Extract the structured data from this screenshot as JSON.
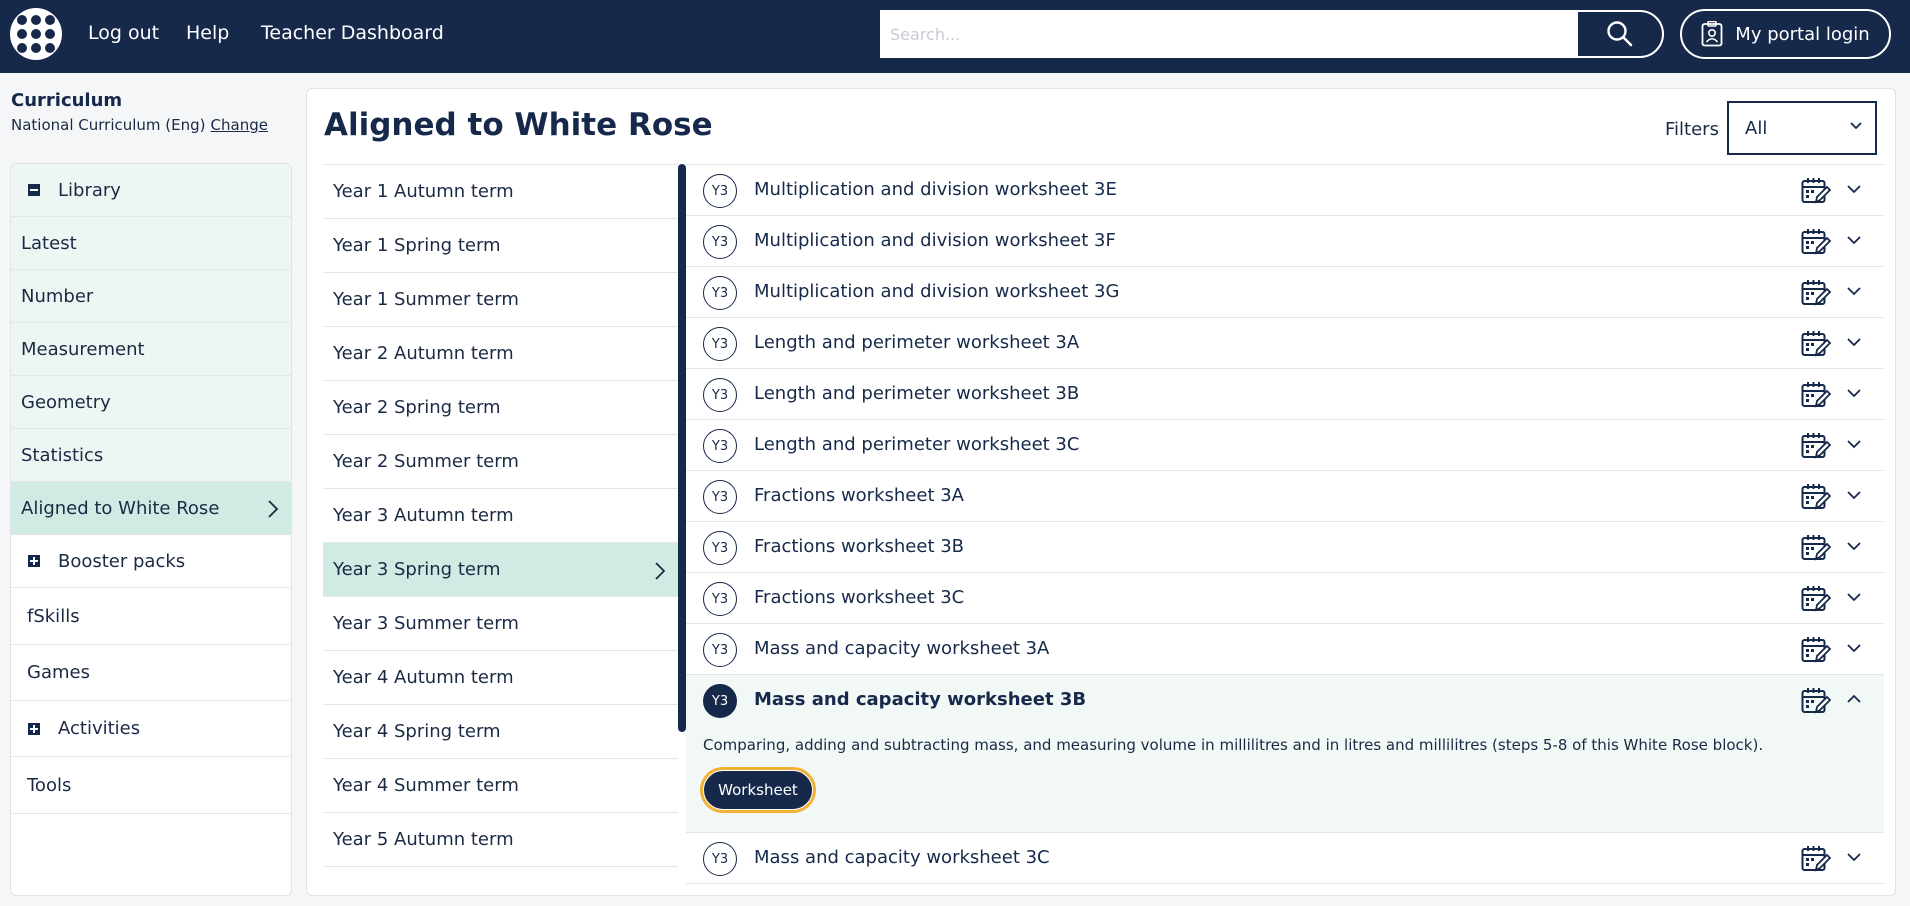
{
  "nav": {
    "links": [
      "Log out",
      "Help",
      "Teacher Dashboard"
    ],
    "search_placeholder": "Search...",
    "portal_label": "My portal login"
  },
  "sidebar": {
    "curriculum_title": "Curriculum",
    "curriculum_name": "National Curriculum (Eng)",
    "change_label": "Change",
    "items": [
      {
        "label": "Library",
        "icon": "minus-box-icon"
      },
      {
        "label": "Latest"
      },
      {
        "label": "Number"
      },
      {
        "label": "Measurement"
      },
      {
        "label": "Geometry"
      },
      {
        "label": "Statistics"
      },
      {
        "label": "Aligned to White Rose",
        "active": true
      },
      {
        "label": "Booster packs",
        "icon": "plus-box-icon"
      },
      {
        "label": "fSkills"
      },
      {
        "label": "Games"
      },
      {
        "label": "Activities",
        "icon": "plus-box-icon"
      },
      {
        "label": "Tools"
      }
    ]
  },
  "main": {
    "title": "Aligned to White Rose",
    "filters_label": "Filters",
    "filters_value": "All",
    "terms": [
      "Year 1 Autumn term",
      "Year 1 Spring term",
      "Year 1 Summer term",
      "Year 2 Autumn term",
      "Year 2 Spring term",
      "Year 2 Summer term",
      "Year 3 Autumn term",
      "Year 3 Spring term",
      "Year 3 Summer term",
      "Year 4 Autumn term",
      "Year 4 Spring term",
      "Year 4 Summer term",
      "Year 5 Autumn term"
    ],
    "active_term": "Year 3 Spring term",
    "resources": [
      {
        "badge": "Y3",
        "title": "Multiplication and division worksheet 3E"
      },
      {
        "badge": "Y3",
        "title": "Multiplication and division worksheet 3F"
      },
      {
        "badge": "Y3",
        "title": "Multiplication and division worksheet 3G"
      },
      {
        "badge": "Y3",
        "title": "Length and perimeter worksheet 3A"
      },
      {
        "badge": "Y3",
        "title": "Length and perimeter worksheet 3B"
      },
      {
        "badge": "Y3",
        "title": "Length and perimeter worksheet 3C"
      },
      {
        "badge": "Y3",
        "title": "Fractions worksheet 3A"
      },
      {
        "badge": "Y3",
        "title": "Fractions worksheet 3B"
      },
      {
        "badge": "Y3",
        "title": "Fractions worksheet 3C"
      },
      {
        "badge": "Y3",
        "title": "Mass and capacity worksheet 3A"
      },
      {
        "badge": "Y3",
        "title": "Mass and capacity worksheet 3B",
        "expanded": true,
        "description": "Comparing, adding and subtracting mass, and measuring volume in millilitres and in litres and millilitres (steps 5-8 of this White Rose block).",
        "button": "Worksheet"
      },
      {
        "badge": "Y3",
        "title": "Mass and capacity worksheet 3C"
      }
    ]
  },
  "colors": {
    "navy": "#16294a",
    "mint_active": "#d0ebe3",
    "mint_light": "#eef6f4",
    "focus_ring": "#f2b233"
  }
}
